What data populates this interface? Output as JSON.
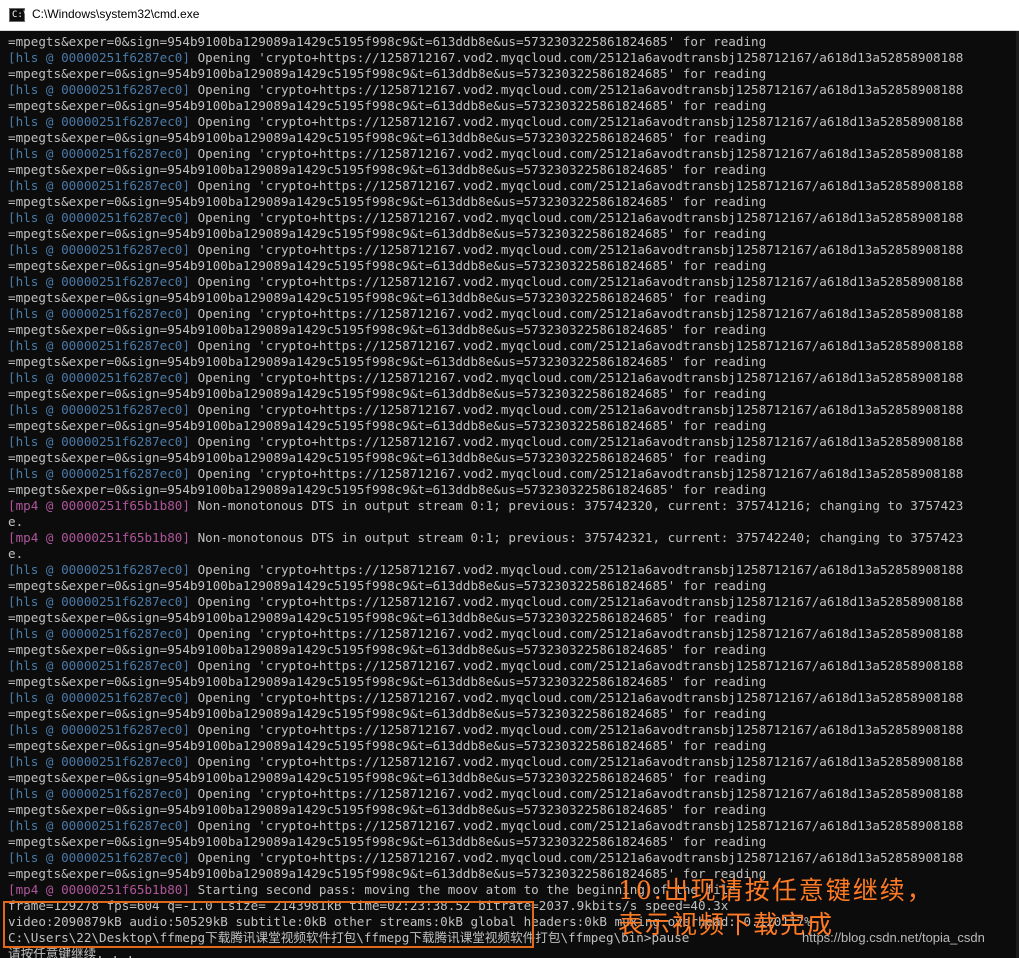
{
  "window": {
    "title": "C:\\Windows\\system32\\cmd.exe",
    "icon": "cmd-icon",
    "icon_glyph": "C:\\"
  },
  "colors": {
    "console_bg": "#0c0c0c",
    "console_text": "#c0c0c0",
    "hls_prefix": "#4a7aa8",
    "mp4_prefix": "#b0569c",
    "annotation": "#ff7a24",
    "highlight_border": "#e06a1a"
  },
  "console": {
    "lines": [
      {
        "prefix": "",
        "text": "=mpegts&exper=0&sign=954b9100ba129089a1429c5195f998c9&t=613ddb8e&us=5732303225861824685' for reading"
      },
      {
        "prefix": "[hls @ 00000251f6287ec0]",
        "text": " Opening 'crypto+https://1258712167.vod2.myqcloud.com/25121a6avodtransbj1258712167/a618d13a52858908188"
      },
      {
        "prefix": "",
        "text": "=mpegts&exper=0&sign=954b9100ba129089a1429c5195f998c9&t=613ddb8e&us=5732303225861824685' for reading"
      },
      {
        "prefix": "[hls @ 00000251f6287ec0]",
        "text": " Opening 'crypto+https://1258712167.vod2.myqcloud.com/25121a6avodtransbj1258712167/a618d13a52858908188"
      },
      {
        "prefix": "",
        "text": "=mpegts&exper=0&sign=954b9100ba129089a1429c5195f998c9&t=613ddb8e&us=5732303225861824685' for reading"
      },
      {
        "prefix": "[hls @ 00000251f6287ec0]",
        "text": " Opening 'crypto+https://1258712167.vod2.myqcloud.com/25121a6avodtransbj1258712167/a618d13a52858908188"
      },
      {
        "prefix": "",
        "text": "=mpegts&exper=0&sign=954b9100ba129089a1429c5195f998c9&t=613ddb8e&us=5732303225861824685' for reading"
      },
      {
        "prefix": "[hls @ 00000251f6287ec0]",
        "text": " Opening 'crypto+https://1258712167.vod2.myqcloud.com/25121a6avodtransbj1258712167/a618d13a52858908188"
      },
      {
        "prefix": "",
        "text": "=mpegts&exper=0&sign=954b9100ba129089a1429c5195f998c9&t=613ddb8e&us=5732303225861824685' for reading"
      },
      {
        "prefix": "[hls @ 00000251f6287ec0]",
        "text": " Opening 'crypto+https://1258712167.vod2.myqcloud.com/25121a6avodtransbj1258712167/a618d13a52858908188"
      },
      {
        "prefix": "",
        "text": "=mpegts&exper=0&sign=954b9100ba129089a1429c5195f998c9&t=613ddb8e&us=5732303225861824685' for reading"
      },
      {
        "prefix": "[hls @ 00000251f6287ec0]",
        "text": " Opening 'crypto+https://1258712167.vod2.myqcloud.com/25121a6avodtransbj1258712167/a618d13a52858908188"
      },
      {
        "prefix": "",
        "text": "=mpegts&exper=0&sign=954b9100ba129089a1429c5195f998c9&t=613ddb8e&us=5732303225861824685' for reading"
      },
      {
        "prefix": "[hls @ 00000251f6287ec0]",
        "text": " Opening 'crypto+https://1258712167.vod2.myqcloud.com/25121a6avodtransbj1258712167/a618d13a52858908188"
      },
      {
        "prefix": "",
        "text": "=mpegts&exper=0&sign=954b9100ba129089a1429c5195f998c9&t=613ddb8e&us=5732303225861824685' for reading"
      },
      {
        "prefix": "[hls @ 00000251f6287ec0]",
        "text": " Opening 'crypto+https://1258712167.vod2.myqcloud.com/25121a6avodtransbj1258712167/a618d13a52858908188"
      },
      {
        "prefix": "",
        "text": "=mpegts&exper=0&sign=954b9100ba129089a1429c5195f998c9&t=613ddb8e&us=5732303225861824685' for reading"
      },
      {
        "prefix": "[hls @ 00000251f6287ec0]",
        "text": " Opening 'crypto+https://1258712167.vod2.myqcloud.com/25121a6avodtransbj1258712167/a618d13a52858908188"
      },
      {
        "prefix": "",
        "text": "=mpegts&exper=0&sign=954b9100ba129089a1429c5195f998c9&t=613ddb8e&us=5732303225861824685' for reading"
      },
      {
        "prefix": "[hls @ 00000251f6287ec0]",
        "text": " Opening 'crypto+https://1258712167.vod2.myqcloud.com/25121a6avodtransbj1258712167/a618d13a52858908188"
      },
      {
        "prefix": "",
        "text": "=mpegts&exper=0&sign=954b9100ba129089a1429c5195f998c9&t=613ddb8e&us=5732303225861824685' for reading"
      },
      {
        "prefix": "[hls @ 00000251f6287ec0]",
        "text": " Opening 'crypto+https://1258712167.vod2.myqcloud.com/25121a6avodtransbj1258712167/a618d13a52858908188"
      },
      {
        "prefix": "",
        "text": "=mpegts&exper=0&sign=954b9100ba129089a1429c5195f998c9&t=613ddb8e&us=5732303225861824685' for reading"
      },
      {
        "prefix": "[hls @ 00000251f6287ec0]",
        "text": " Opening 'crypto+https://1258712167.vod2.myqcloud.com/25121a6avodtransbj1258712167/a618d13a52858908188"
      },
      {
        "prefix": "",
        "text": "=mpegts&exper=0&sign=954b9100ba129089a1429c5195f998c9&t=613ddb8e&us=5732303225861824685' for reading"
      },
      {
        "prefix": "[hls @ 00000251f6287ec0]",
        "text": " Opening 'crypto+https://1258712167.vod2.myqcloud.com/25121a6avodtransbj1258712167/a618d13a52858908188"
      },
      {
        "prefix": "",
        "text": "=mpegts&exper=0&sign=954b9100ba129089a1429c5195f998c9&t=613ddb8e&us=5732303225861824685' for reading"
      },
      {
        "prefix": "[hls @ 00000251f6287ec0]",
        "text": " Opening 'crypto+https://1258712167.vod2.myqcloud.com/25121a6avodtransbj1258712167/a618d13a52858908188"
      },
      {
        "prefix": "",
        "text": "=mpegts&exper=0&sign=954b9100ba129089a1429c5195f998c9&t=613ddb8e&us=5732303225861824685' for reading"
      },
      {
        "prefix": "[mp4 @ 00000251f65b1b80]",
        "text": " Non-monotonous DTS in output stream 0:1; previous: 375742320, current: 375741216; changing to 3757423"
      },
      {
        "prefix": "",
        "text": "e."
      },
      {
        "prefix": "[mp4 @ 00000251f65b1b80]",
        "text": " Non-monotonous DTS in output stream 0:1; previous: 375742321, current: 375742240; changing to 3757423"
      },
      {
        "prefix": "",
        "text": "e."
      },
      {
        "prefix": "[hls @ 00000251f6287ec0]",
        "text": " Opening 'crypto+https://1258712167.vod2.myqcloud.com/25121a6avodtransbj1258712167/a618d13a52858908188"
      },
      {
        "prefix": "",
        "text": "=mpegts&exper=0&sign=954b9100ba129089a1429c5195f998c9&t=613ddb8e&us=5732303225861824685' for reading"
      },
      {
        "prefix": "[hls @ 00000251f6287ec0]",
        "text": " Opening 'crypto+https://1258712167.vod2.myqcloud.com/25121a6avodtransbj1258712167/a618d13a52858908188"
      },
      {
        "prefix": "",
        "text": "=mpegts&exper=0&sign=954b9100ba129089a1429c5195f998c9&t=613ddb8e&us=5732303225861824685' for reading"
      },
      {
        "prefix": "[hls @ 00000251f6287ec0]",
        "text": " Opening 'crypto+https://1258712167.vod2.myqcloud.com/25121a6avodtransbj1258712167/a618d13a52858908188"
      },
      {
        "prefix": "",
        "text": "=mpegts&exper=0&sign=954b9100ba129089a1429c5195f998c9&t=613ddb8e&us=5732303225861824685' for reading"
      },
      {
        "prefix": "[hls @ 00000251f6287ec0]",
        "text": " Opening 'crypto+https://1258712167.vod2.myqcloud.com/25121a6avodtransbj1258712167/a618d13a52858908188"
      },
      {
        "prefix": "",
        "text": "=mpegts&exper=0&sign=954b9100ba129089a1429c5195f998c9&t=613ddb8e&us=5732303225861824685' for reading"
      },
      {
        "prefix": "[hls @ 00000251f6287ec0]",
        "text": " Opening 'crypto+https://1258712167.vod2.myqcloud.com/25121a6avodtransbj1258712167/a618d13a52858908188"
      },
      {
        "prefix": "",
        "text": "=mpegts&exper=0&sign=954b9100ba129089a1429c5195f998c9&t=613ddb8e&us=5732303225861824685' for reading"
      },
      {
        "prefix": "[hls @ 00000251f6287ec0]",
        "text": " Opening 'crypto+https://1258712167.vod2.myqcloud.com/25121a6avodtransbj1258712167/a618d13a52858908188"
      },
      {
        "prefix": "",
        "text": "=mpegts&exper=0&sign=954b9100ba129089a1429c5195f998c9&t=613ddb8e&us=5732303225861824685' for reading"
      },
      {
        "prefix": "[hls @ 00000251f6287ec0]",
        "text": " Opening 'crypto+https://1258712167.vod2.myqcloud.com/25121a6avodtransbj1258712167/a618d13a52858908188"
      },
      {
        "prefix": "",
        "text": "=mpegts&exper=0&sign=954b9100ba129089a1429c5195f998c9&t=613ddb8e&us=5732303225861824685' for reading"
      },
      {
        "prefix": "[hls @ 00000251f6287ec0]",
        "text": " Opening 'crypto+https://1258712167.vod2.myqcloud.com/25121a6avodtransbj1258712167/a618d13a52858908188"
      },
      {
        "prefix": "",
        "text": "=mpegts&exper=0&sign=954b9100ba129089a1429c5195f998c9&t=613ddb8e&us=5732303225861824685' for reading"
      },
      {
        "prefix": "[hls @ 00000251f6287ec0]",
        "text": " Opening 'crypto+https://1258712167.vod2.myqcloud.com/25121a6avodtransbj1258712167/a618d13a52858908188"
      },
      {
        "prefix": "",
        "text": "=mpegts&exper=0&sign=954b9100ba129089a1429c5195f998c9&t=613ddb8e&us=5732303225861824685' for reading"
      },
      {
        "prefix": "[hls @ 00000251f6287ec0]",
        "text": " Opening 'crypto+https://1258712167.vod2.myqcloud.com/25121a6avodtransbj1258712167/a618d13a52858908188"
      },
      {
        "prefix": "",
        "text": "=mpegts&exper=0&sign=954b9100ba129089a1429c5195f998c9&t=613ddb8e&us=5732303225861824685' for reading"
      },
      {
        "prefix": "[mp4 @ 00000251f65b1b80]",
        "text": " Starting second pass: moving the moov atom to the beginning of the file"
      },
      {
        "prefix": "",
        "text": "frame=129278 fps=604 q=-1.0 Lsize= 2143981kB time=02:23:38.52 bitrate=2037.9kbits/s speed=40.3x"
      },
      {
        "prefix": "",
        "text": "video:2090879kB audio:50529kB subtitle:0kB other streams:0kB global headers:0kB muxing overhead: 0.120117%"
      },
      {
        "prefix": "",
        "text": "C:\\Users\\22\\Desktop\\ffmepg下载腾讯课堂视频软件打包\\ffmepg下载腾讯课堂视频软件打包\\ffmpeg\\bin>pause"
      },
      {
        "prefix": "",
        "text": "请按任意键继续. . ."
      }
    ]
  },
  "annotation": {
    "text": "10.出现请按任意键继续，\n表示视频下载完成"
  },
  "watermark": {
    "text": "https://blog.csdn.net/topia_csdn"
  }
}
